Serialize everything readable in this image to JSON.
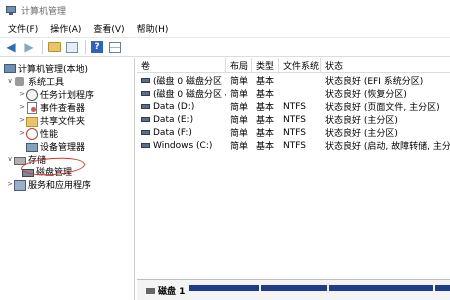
{
  "window": {
    "title": "计算机管理"
  },
  "menu": [
    "文件(F)",
    "操作(A)",
    "查看(V)",
    "帮助(H)"
  ],
  "toolbar": {
    "help_glyph": "?"
  },
  "tree": {
    "root": "计算机管理(本地)",
    "system_tools": "系统工具",
    "task_scheduler": "任务计划程序",
    "event_viewer": "事件查看器",
    "shared_folders": "共享文件夹",
    "performance": "性能",
    "device_manager": "设备管理器",
    "storage": "存储",
    "disk_management": "磁盘管理",
    "services_apps": "服务和应用程序"
  },
  "table": {
    "headers": [
      "卷",
      "布局",
      "类型",
      "文件系统",
      "状态"
    ],
    "rows": [
      {
        "volume": "(磁盘 0 磁盘分区 1)",
        "layout": "简单",
        "type": "基本",
        "fs": "",
        "status": "状态良好 (EFI 系统分区)"
      },
      {
        "volume": "(磁盘 0 磁盘分区 4)",
        "layout": "简单",
        "type": "基本",
        "fs": "",
        "status": "状态良好 (恢复分区)"
      },
      {
        "volume": "Data (D:)",
        "layout": "简单",
        "type": "基本",
        "fs": "NTFS",
        "status": "状态良好 (页面文件, 主分区)"
      },
      {
        "volume": "Data (E:)",
        "layout": "简单",
        "type": "基本",
        "fs": "NTFS",
        "status": "状态良好 (主分区)"
      },
      {
        "volume": "Data (F:)",
        "layout": "简单",
        "type": "基本",
        "fs": "NTFS",
        "status": "状态良好 (主分区)"
      },
      {
        "volume": "Windows (C:)",
        "layout": "简单",
        "type": "基本",
        "fs": "NTFS",
        "status": "状态良好 (启动, 故障转储, 主分区)"
      }
    ]
  },
  "disk_panel": {
    "label": "磁盘 1",
    "sub": ""
  },
  "colors": {
    "partition_bar": "#1f3c8c",
    "highlight_ellipse": "#d9302a"
  }
}
